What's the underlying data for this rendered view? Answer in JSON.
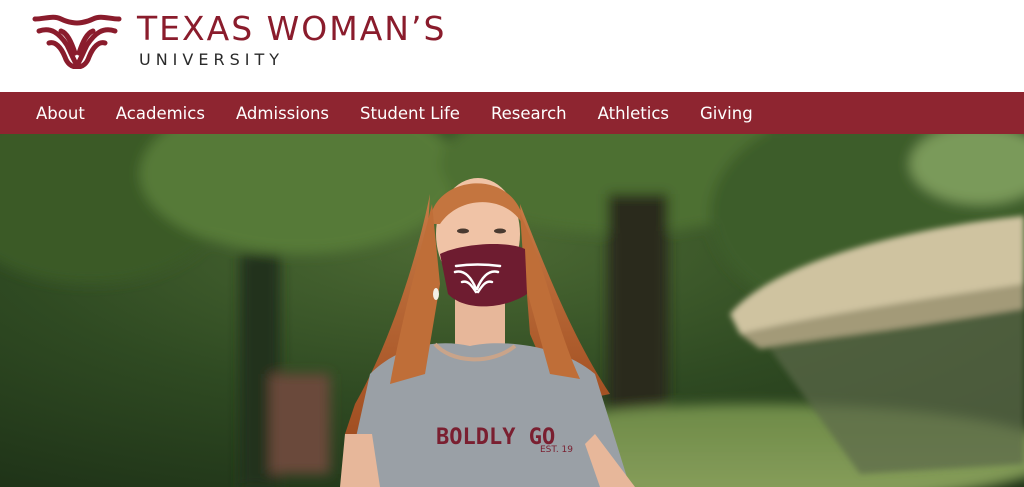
{
  "brand": {
    "name": "TEXAS WOMAN’S",
    "subtitle": "UNIVERSITY",
    "logo_icon": "twu-wave-icon",
    "primary_color": "#8e2530",
    "text_color": "#2a2a2a"
  },
  "nav": {
    "items": [
      {
        "label": "About"
      },
      {
        "label": "Academics"
      },
      {
        "label": "Admissions"
      },
      {
        "label": "Student Life"
      },
      {
        "label": "Research"
      },
      {
        "label": "Athletics"
      },
      {
        "label": "Giving"
      }
    ]
  },
  "hero": {
    "shirt_text": "BOLDLY GO",
    "shirt_subtext": "EST. 19"
  }
}
